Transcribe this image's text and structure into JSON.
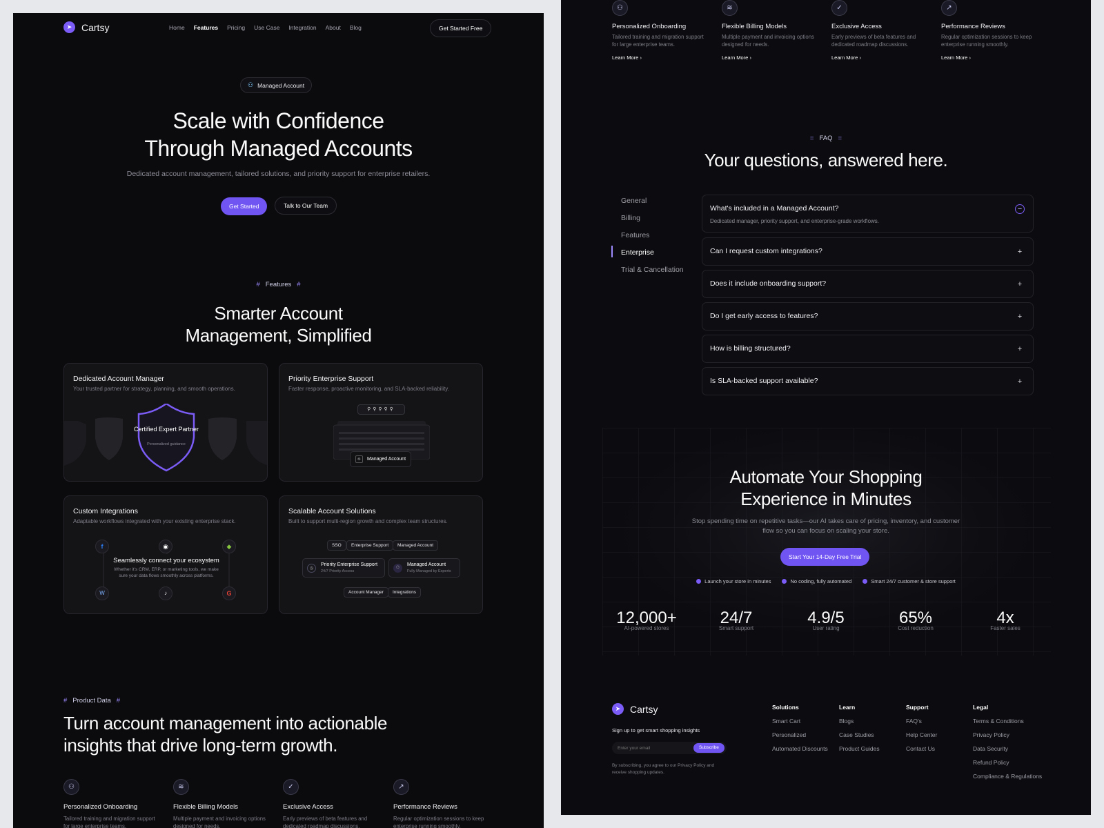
{
  "left": {
    "brand": "Cartsy",
    "nav": [
      "Home",
      "Features",
      "Pricing",
      "Use Case",
      "Integration",
      "About",
      "Blog"
    ],
    "nav_active": "Features",
    "cta_header": "Get Started Free",
    "hero": {
      "pill": "Managed Account",
      "title_line1": "Scale with Confidence",
      "title_line2": "Through Managed Accounts",
      "subtitle": "Dedicated account management, tailored solutions, and priority support for enterprise retailers.",
      "primary_cta": "Get Started",
      "secondary_cta": "Talk to Our Team"
    },
    "features": {
      "eyebrow": "Features",
      "title_line1": "Smarter Account",
      "title_line2": "Management, Simplified",
      "cards": [
        {
          "title": "Dedicated Account Manager",
          "desc": "Your trusted partner for strategy, planning, and smooth operations.",
          "badge_title": "Certified Expert Partner",
          "badge_sub": "Personalized guidance"
        },
        {
          "title": "Priority Enterprise Support",
          "desc": "Faster response, proactive monitoring, and SLA-backed reliability.",
          "chip": "Managed Account"
        },
        {
          "title": "Custom Integrations",
          "desc": "Adaptable workflows integrated with your existing enterprise stack.",
          "center_title": "Seamlessly connect your ecosystem",
          "center_desc": "Whether it's CRM, ERP, or marketing tools, we make sure your data flows smoothly across platforms."
        },
        {
          "title": "Scalable Account Solutions",
          "desc": "Built to support multi-region growth and complex team structures.",
          "tags_top": [
            "SSO",
            "Enterprise Support",
            "Managed Account"
          ],
          "mid_left_title": "Priority Enterprise Support",
          "mid_left_sub": "24/7 Priority Access",
          "mid_right_title": "Managed Account",
          "mid_right_sub": "Fully Managed by Experts",
          "tags_bottom": [
            "Account Manager",
            "Integrations"
          ]
        }
      ]
    },
    "product": {
      "eyebrow": "Product Data",
      "title_line1": "Turn account management into actionable",
      "title_line2": "insights that drive long-term growth.",
      "items": [
        {
          "title": "Personalized Onboarding",
          "desc": "Tailored training and migration support for large enterprise teams."
        },
        {
          "title": "Flexible Billing Models",
          "desc": "Multiple payment and invoicing options designed for needs."
        },
        {
          "title": "Exclusive Access",
          "desc": "Early previews of beta features and dedicated roadmap discussions."
        },
        {
          "title": "Performance Reviews",
          "desc": "Regular optimization sessions to keep enterprise running smoothly."
        }
      ]
    }
  },
  "right": {
    "top_items": [
      {
        "title": "Personalized Onboarding",
        "desc": "Tailored training and migration support for large enterprise teams.",
        "link": "Learn More"
      },
      {
        "title": "Flexible Billing Models",
        "desc": "Multiple payment and invoicing options designed for needs.",
        "link": "Learn More"
      },
      {
        "title": "Exclusive Access",
        "desc": "Early previews of beta features and dedicated roadmap discussions.",
        "link": "Learn More"
      },
      {
        "title": "Performance Reviews",
        "desc": "Regular optimization sessions to keep enterprise running smoothly.",
        "link": "Learn More"
      }
    ],
    "faq": {
      "eyebrow": "FAQ",
      "title": "Your questions, answered here.",
      "categories": [
        "General",
        "Billing",
        "Features",
        "Enterprise",
        "Trial & Cancellation"
      ],
      "active_category": "Enterprise",
      "items": [
        {
          "q": "What's included in a Managed Account?",
          "a": "Dedicated manager, priority support, and enterprise-grade workflows."
        },
        {
          "q": "Can I request custom integrations?"
        },
        {
          "q": "Does it include onboarding support?"
        },
        {
          "q": "Do I get early access to features?"
        },
        {
          "q": "How is billing structured?"
        },
        {
          "q": "Is SLA-backed support available?"
        }
      ]
    },
    "cta": {
      "title_line1": "Automate Your Shopping",
      "title_line2": "Experience in Minutes",
      "desc_line1": "Stop spending time on repetitive tasks—our AI takes care of pricing, inventory, and customer",
      "desc_line2": "flow so you can focus on scaling your store.",
      "button": "Start Your 14-Day Free Trial",
      "checks": [
        "Launch your store in minutes",
        "No coding, fully automated",
        "Smart 24/7 customer & store support"
      ]
    },
    "stats": [
      {
        "value": "12,000+",
        "label": "AI-powered stores"
      },
      {
        "value": "24/7",
        "label": "Smart support"
      },
      {
        "value": "4.9/5",
        "label": "User rating"
      },
      {
        "value": "65%",
        "label": "Cost reduction"
      },
      {
        "value": "4x",
        "label": "Faster sales"
      }
    ],
    "footer": {
      "brand": "Cartsy",
      "newsletter_label": "Sign up to get smart shopping insights",
      "email_placeholder": "Enter your email",
      "subscribe": "Subscribe",
      "note_line1": "By subscribing, you agree to our Privacy Policy and",
      "note_line2": "receive shopping updates.",
      "columns": [
        {
          "title": "Solutions",
          "links": [
            "Smart Cart",
            "Personalized",
            "Automated Discounts"
          ]
        },
        {
          "title": "Learn",
          "links": [
            "Blogs",
            "Case Studies",
            "Product Guides"
          ]
        },
        {
          "title": "Support",
          "links": [
            "FAQ's",
            "Help Center",
            "Contact Us"
          ]
        },
        {
          "title": "Legal",
          "links": [
            "Terms & Conditions",
            "Privacy Policy",
            "Data Security",
            "Refund Policy",
            "Compliance & Regulations"
          ]
        }
      ]
    }
  },
  "colors": {
    "accent": "#7155f3",
    "background": "#0b0b0e",
    "card": "#141417"
  }
}
